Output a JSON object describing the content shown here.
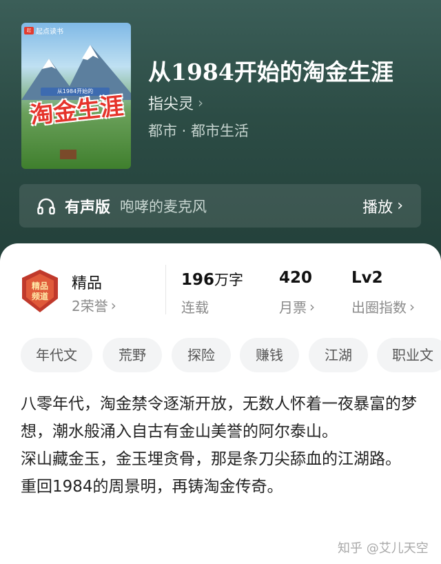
{
  "book": {
    "cover_badge": "起点读书",
    "cover_title": "淘金生涯",
    "cover_subtitle": "从1984开始的",
    "title": "从1984开始的淘金生涯",
    "author": "指尖灵",
    "genre": "都市 · 都市生活"
  },
  "audio": {
    "icon": "headphones-icon",
    "label": "有声版",
    "narrator": "咆哮的麦克风",
    "play_label": "播放"
  },
  "stats": {
    "badge_icon": "premium-badge-icon",
    "quality": "精品",
    "honors": "2荣誉",
    "word_count": "196",
    "word_unit": "万字",
    "status": "连载",
    "monthly_votes": "420",
    "monthly_votes_label": "月票",
    "level": "Lv2",
    "level_label": "出圈指数"
  },
  "tags": [
    "年代文",
    "荒野",
    "探险",
    "赚钱",
    "江湖",
    "职业文"
  ],
  "description": [
    "八零年代，淘金禁令逐渐开放，无数人怀着一夜暴富的梦想，潮水般涌入自古有金山美誉的阿尔泰山。",
    "深山藏金玉，金玉埋贪骨，那是条刀尖舔血的江湖路。",
    "重回1984的周景明，再铸淘金传奇。"
  ],
  "watermark": "知乎 @艾儿天空",
  "colors": {
    "hero_bg": "#2c4c45",
    "text_dark": "#222222",
    "text_muted": "#8a8a8a",
    "tag_bg": "#f3f4f5"
  }
}
